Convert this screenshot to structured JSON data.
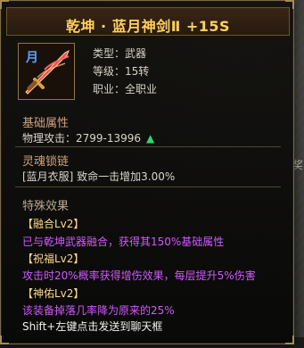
{
  "item": {
    "name": "乾坤 · 蓝月神剑Ⅱ  +15S",
    "icon_label": "月",
    "icon_name": "sword-icon"
  },
  "basic_info": {
    "type_line": "类型：武器",
    "level_line": "等级：15转",
    "job_line": "职业：全职业"
  },
  "base_attributes": {
    "title": "基础属性",
    "attack_line": "物理攻击：2799-13996",
    "arrow_icon": "up-arrow-icon"
  },
  "soul_lock": {
    "title": "灵魂锁链",
    "line": "[蓝月衣服] 致命一击增加3.00%"
  },
  "special_effects": {
    "title": "特殊效果",
    "effects": [
      {
        "name": "【融合Lv2】",
        "description": "已与乾坤武器融合，获得其150%基础属性"
      },
      {
        "name": "【祝福Lv2】",
        "description": "攻击时20%概率获得增伤效果，每层提升5%伤害"
      },
      {
        "name": "【神佑Lv2】",
        "description": "该装备掉落几率降为原来的25%"
      }
    ]
  },
  "footer": {
    "hint": "Shift+左键点击发送到聊天框"
  },
  "background": {
    "side_char": "奖"
  },
  "colors": {
    "title": "#ffd15b",
    "section_title": "#d1a27a",
    "effect_head": "#ffd98b",
    "effect_body": "#cf5aff",
    "up_arrow": "#33d46d",
    "icon_label": "#5aa4ff"
  }
}
